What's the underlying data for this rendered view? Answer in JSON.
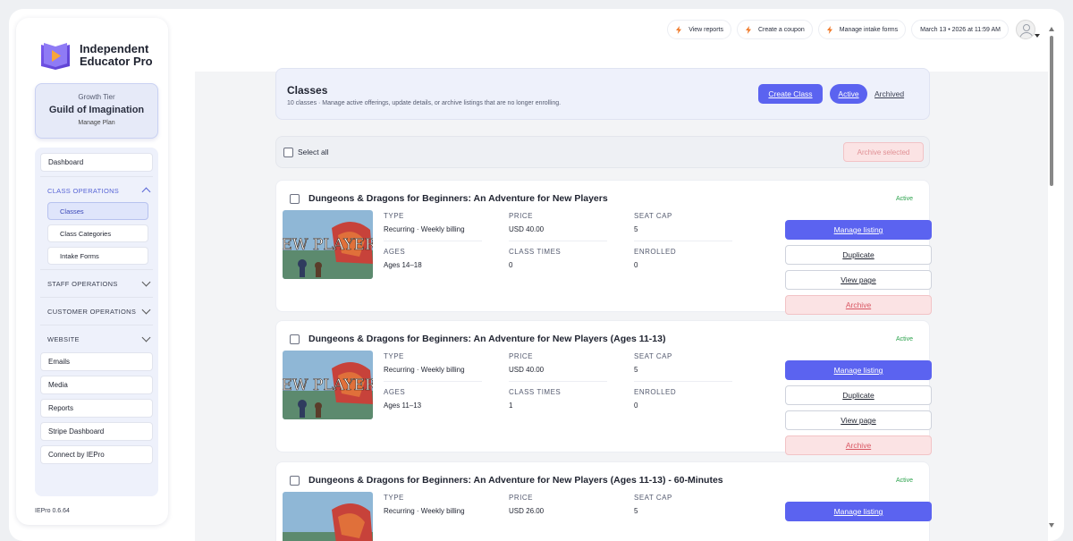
{
  "brand": {
    "line1": "Independent",
    "line2": "Educator Pro"
  },
  "tier": {
    "label": "Growth Tier",
    "name": "Guild of Imagination",
    "manage": "Manage Plan"
  },
  "nav": {
    "dashboard": "Dashboard",
    "class_ops": {
      "label": "CLASS OPERATIONS",
      "items": [
        "Classes",
        "Class Categories",
        "Intake Forms"
      ]
    },
    "staff_ops": "STAFF OPERATIONS",
    "customer_ops": "CUSTOMER OPERATIONS",
    "website": "WEBSITE",
    "emails": "Emails",
    "media": "Media",
    "reports": "Reports",
    "stripe": "Stripe Dashboard",
    "connect": "Connect by IEPro"
  },
  "version": "IEPro 0.6.64",
  "topbar": {
    "view_reports": "View reports",
    "create_coupon": "Create a coupon",
    "manage_intake": "Manage intake forms",
    "datetime": "March 13 • 2026 at 11:59 AM"
  },
  "header": {
    "title": "Classes",
    "subtitle": "10 classes · Manage active offerings, update details, or archive listings that are no longer enrolling.",
    "create_class": "Create Class",
    "active": "Active",
    "archived": "Archived"
  },
  "select": {
    "label": "Select all",
    "archive_selected": "Archive selected"
  },
  "labels": {
    "type": "TYPE",
    "price": "PRICE",
    "seat_cap": "SEAT CAP",
    "ages": "AGES",
    "class_times": "CLASS TIMES",
    "enrolled": "ENROLLED"
  },
  "actions": {
    "manage": "Manage listing",
    "duplicate": "Duplicate",
    "view": "View page",
    "archive": "Archive"
  },
  "thumb_text": "NEW PLAYERS",
  "classes": [
    {
      "title": "Dungeons & Dragons for Beginners: An Adventure for New Players",
      "status": "Active",
      "type": "Recurring · Weekly billing",
      "price": "USD 40.00",
      "seat_cap": "5",
      "ages": "Ages 14–18",
      "class_times": "0",
      "enrolled": "0"
    },
    {
      "title": "Dungeons & Dragons for Beginners: An Adventure for New Players (Ages 11-13)",
      "status": "Active",
      "type": "Recurring · Weekly billing",
      "price": "USD 40.00",
      "seat_cap": "5",
      "ages": "Ages 11–13",
      "class_times": "1",
      "enrolled": "0"
    },
    {
      "title": "Dungeons & Dragons for Beginners: An Adventure for New Players (Ages 11-13) - 60-Minutes",
      "status": "Active",
      "type": "Recurring · Weekly billing",
      "price": "USD 26.00",
      "seat_cap": "5"
    }
  ],
  "colors": {
    "accent": "#5b63f0",
    "active_status": "#2ba24c",
    "archive": "#d95763"
  }
}
